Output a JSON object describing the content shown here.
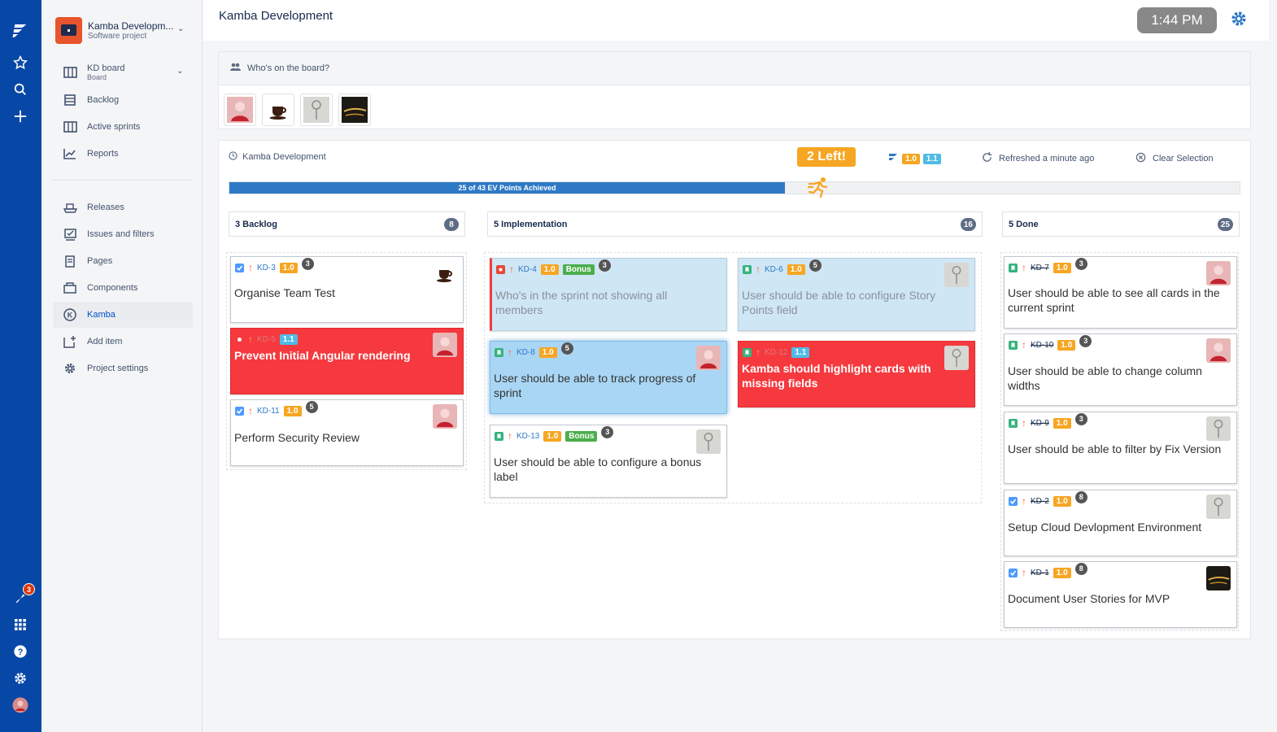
{
  "app": {
    "project_name": "Kamba Developm...",
    "project_type": "Software project",
    "board_name": "KD board",
    "board_type": "Board",
    "notifications_count": "3"
  },
  "sidebar": {
    "items": [
      {
        "label": "Backlog"
      },
      {
        "label": "Active sprints"
      },
      {
        "label": "Reports"
      },
      {
        "label": "Releases"
      },
      {
        "label": "Issues and filters"
      },
      {
        "label": "Pages"
      },
      {
        "label": "Components"
      },
      {
        "label": "Kamba"
      },
      {
        "label": "Add item"
      },
      {
        "label": "Project settings"
      }
    ]
  },
  "header": {
    "title": "Kamba Development",
    "time": "1:44 PM"
  },
  "who_panel": {
    "title": "Who's on the board?"
  },
  "board": {
    "title": "Kamba Development",
    "left_badge": "2 Left!",
    "versions": [
      "1.0",
      "1.1"
    ],
    "refreshed": "Refreshed a minute ago",
    "clear": "Clear Selection",
    "progress_text": "25 of 43 EV Points Achieved",
    "progress_value": 0.55,
    "columns": [
      {
        "name": "3 Backlog",
        "count": "8"
      },
      {
        "name": "5 Implementation",
        "count": "16"
      },
      {
        "name": "5 Done",
        "count": "25"
      }
    ]
  },
  "cards": {
    "kd3": {
      "key": "KD-3",
      "version": "1.0",
      "estimate": "3",
      "title": "Organise Team Test"
    },
    "kd5": {
      "key": "KD-5",
      "version": "1.1",
      "title": "Prevent Initial Angular rendering"
    },
    "kd11": {
      "key": "KD-11",
      "version": "1.0",
      "estimate": "5",
      "title": "Perform Security Review"
    },
    "kd4": {
      "key": "KD-4",
      "version": "1.0",
      "bonus": "Bonus",
      "estimate": "3",
      "title": "Who's in the sprint not showing all members"
    },
    "kd8": {
      "key": "KD-8",
      "version": "1.0",
      "estimate": "5",
      "title": "User should be able to track progress of sprint"
    },
    "kd13": {
      "key": "KD-13",
      "version": "1.0",
      "bonus": "Bonus",
      "estimate": "3",
      "title": "User should be able to configure a bonus label"
    },
    "kd6": {
      "key": "KD-6",
      "version": "1.0",
      "estimate": "5",
      "title": "User should be able to configure Story Points field"
    },
    "kd12": {
      "key": "KD-12",
      "version": "1.1",
      "title": "Kamba should highlight cards with missing fields"
    },
    "kd7": {
      "key": "KD-7",
      "version": "1.0",
      "estimate": "3",
      "title": "User should be able to see all cards in the current sprint"
    },
    "kd10": {
      "key": "KD-10",
      "version": "1.0",
      "estimate": "3",
      "title": "User should be able to change column widths"
    },
    "kd9": {
      "key": "KD-9",
      "version": "1.0",
      "estimate": "3",
      "title": "User should be able to filter by Fix Version"
    },
    "kd2": {
      "key": "KD-2",
      "version": "1.0",
      "estimate": "8",
      "title": "Setup Cloud Devlopment Environment"
    },
    "kd1": {
      "key": "KD-1",
      "version": "1.0",
      "estimate": "8",
      "title": "Document User Stories for MVP"
    }
  },
  "colors": {
    "nav": "#0747a6",
    "accent": "#2e79c6",
    "red_card": "#f6393e",
    "version_orange": "#f6a623",
    "version_teal": "#4fbbe6",
    "bonus_green": "#4cae4c"
  }
}
